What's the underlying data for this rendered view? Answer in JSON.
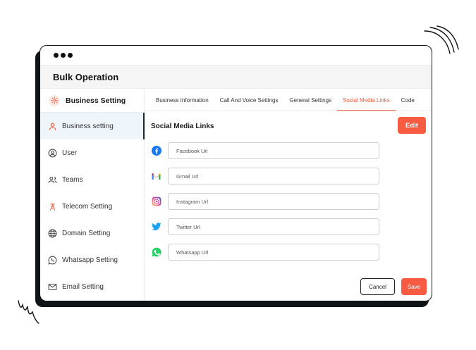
{
  "app": {
    "title": "Bulk Operation"
  },
  "sidebar": {
    "header": {
      "label": "Business Setting",
      "icon": "gear-icon"
    },
    "items": [
      {
        "label": "Business setting",
        "icon": "user-icon",
        "active": true
      },
      {
        "label": "User",
        "icon": "user-circle-icon",
        "active": false
      },
      {
        "label": "Teams",
        "icon": "users-icon",
        "active": false
      },
      {
        "label": "Telecom Setting",
        "icon": "tower-icon",
        "active": false
      },
      {
        "label": "Domain Setting",
        "icon": "globe-icon",
        "active": false
      },
      {
        "label": "Whatsapp Setting",
        "icon": "whatsapp-outline-icon",
        "active": false
      },
      {
        "label": "Email Setting",
        "icon": "mail-icon",
        "active": false
      }
    ]
  },
  "tabs": [
    {
      "label": "Business Information",
      "active": false
    },
    {
      "label": "Call And Voice Settings",
      "active": false
    },
    {
      "label": "General Settings",
      "active": false
    },
    {
      "label": "Social Media Links",
      "active": true
    },
    {
      "label": "Code",
      "active": false
    }
  ],
  "section": {
    "title": "Social Media Links",
    "edit_label": "Edit"
  },
  "links": [
    {
      "icon": "facebook-icon",
      "placeholder": "Facebook Url",
      "value": ""
    },
    {
      "icon": "gmail-icon",
      "placeholder": "Gmail Url",
      "value": ""
    },
    {
      "icon": "instagram-icon",
      "placeholder": "Instagram Url",
      "value": ""
    },
    {
      "icon": "twitter-icon",
      "placeholder": "Twitter Url",
      "value": ""
    },
    {
      "icon": "whatsapp-icon",
      "placeholder": "Whatsapp Url",
      "value": ""
    }
  ],
  "actions": {
    "cancel_label": "Cancel",
    "save_label": "Save"
  },
  "colors": {
    "accent": "#f75c42",
    "active_tab": "#f05a3c",
    "sidebar_active_bg": "#eef5fb"
  }
}
